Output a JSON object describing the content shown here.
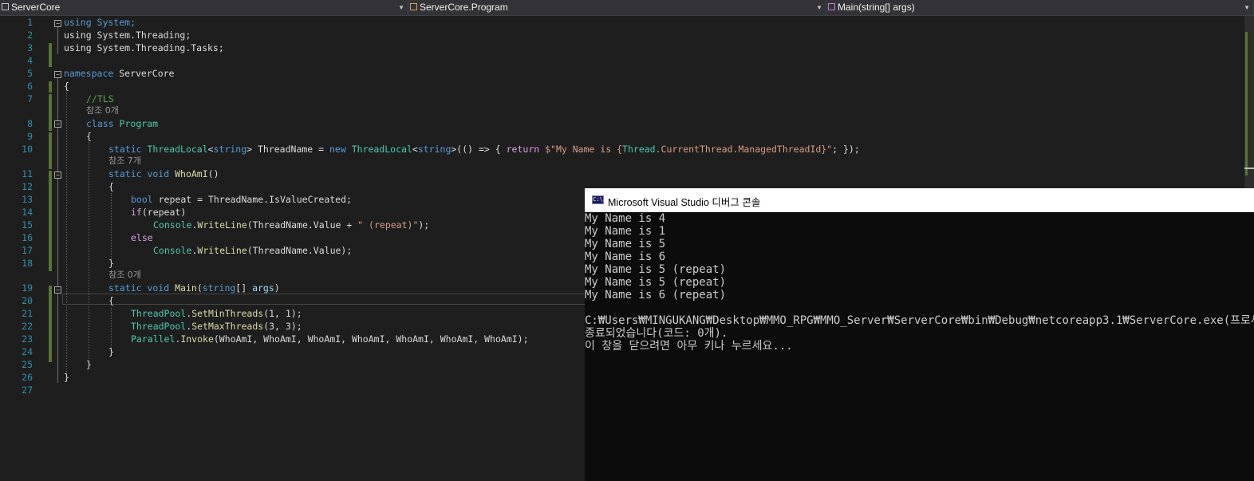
{
  "navbar": {
    "project": "ServerCore",
    "class": "ServerCore.Program",
    "member": "Main(string[] args)"
  },
  "code": {
    "l1": "using System;",
    "l2": "using System.Threading;",
    "l3": "using System.Threading.Tasks;",
    "l5_kw": "namespace",
    "l5_name": " ServerCore",
    "l6": "{",
    "l7": "//TLS",
    "ref0a": "참조 0개",
    "l8_kw": "class",
    "l8_name": " Program",
    "l9": "{",
    "l10_a": "static",
    "l10_b": "ThreadLocal",
    "l10_c": "<",
    "l10_d": "string",
    "l10_e": "> ThreadName = ",
    "l10_f": "new",
    "l10_g": "ThreadLocal",
    "l10_h": "<",
    "l10_i": "string",
    "l10_j": ">(() => { ",
    "l10_k": "return",
    "l10_l": "$\"My Name is {",
    "l10_m": "Thread",
    "l10_n": ".CurrentThread.ManagedThreadId}\"",
    "l10_o": "; });",
    "ref7": "참조 7개",
    "l11_a": "static void",
    "l11_b": "WhoAmI",
    "l11_c": "()",
    "l12": "{",
    "l13_a": "bool",
    "l13_b": " repeat = ThreadName.IsValueCreated;",
    "l14_a": "if",
    "l14_b": "(repeat)",
    "l15_a": "Console",
    "l15_b": ".",
    "l15_c": "WriteLine",
    "l15_d": "(ThreadName.Value + ",
    "l15_e": "\" (repeat)\"",
    "l15_f": ");",
    "l16": "else",
    "l17_a": "Console",
    "l17_b": ".",
    "l17_c": "WriteLine",
    "l17_d": "(ThreadName.Value);",
    "l18": "}",
    "ref0b": "참조 0개",
    "l19_a": "static void",
    "l19_b": "Main",
    "l19_c": "(",
    "l19_d": "string",
    "l19_e": "[] ",
    "l19_f": "args",
    "l19_g": ")",
    "l20": "{",
    "l21_a": "ThreadPool",
    "l21_b": ".",
    "l21_c": "SetMinThreads",
    "l21_d": "(1, 1);",
    "l22_a": "ThreadPool",
    "l22_b": ".",
    "l22_c": "SetMaxThreads",
    "l22_d": "(3, 3);",
    "l23_a": "Parallel",
    "l23_b": ".",
    "l23_c": "Invoke",
    "l23_d": "(WhoAmI, WhoAmI, WhoAmI, WhoAmI, WhoAmI, WhoAmI, WhoAmI);",
    "l24": "}",
    "l25": "}",
    "l26": "}"
  },
  "line_numbers": [
    "1",
    "2",
    "3",
    "4",
    "5",
    "6",
    "7",
    "8",
    "9",
    "10",
    "11",
    "12",
    "13",
    "14",
    "15",
    "16",
    "17",
    "18",
    "19",
    "20",
    "21",
    "22",
    "23",
    "24",
    "25",
    "26",
    "27"
  ],
  "console": {
    "title": "Microsoft Visual Studio 디버그 콘솔",
    "icon_text": "C:\\",
    "lines": [
      "My Name is 4",
      "My Name is 1",
      "My Name is 5",
      "My Name is 6",
      "My Name is 5 (repeat)",
      "My Name is 5 (repeat)",
      "My Name is 6 (repeat)",
      "",
      "C:₩Users₩MINGUKANG₩Desktop₩MMO_RPG₩MMO_Server₩ServerCore₩bin₩Debug₩netcoreapp3.1₩ServerCore.exe(프로세스",
      "종료되었습니다(코드: 0개).",
      "이 창을 닫으려면 아무 키나 누르세요..."
    ]
  },
  "colors": {
    "keyword": "#569cd6",
    "type": "#4ec9b0",
    "method": "#dcdcaa",
    "string": "#d69d85",
    "comment": "#57a64a",
    "line_number": "#2b91af"
  }
}
